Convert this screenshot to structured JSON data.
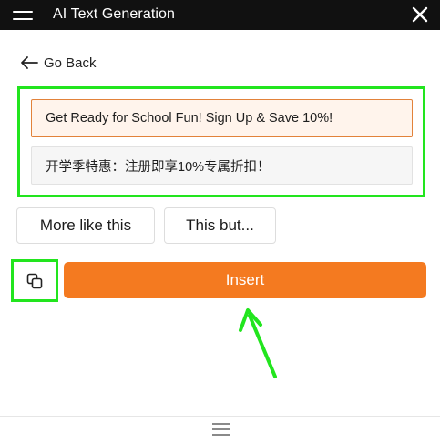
{
  "window": {
    "title": "AI Text Generation",
    "menu_icon": "hamburger-menu-icon",
    "close_icon": "close-x-icon"
  },
  "nav": {
    "back_label": "Go Back",
    "back_icon": "arrow-left-icon"
  },
  "results": [
    {
      "text": "Get Ready for School Fun! Sign Up & Save 10%!",
      "selected": true
    },
    {
      "text": "开学季特惠：注册即享10%专属折扣！",
      "selected": false
    }
  ],
  "actions": {
    "more_like_this": "More like this",
    "this_but": "This but...",
    "copy_icon": "copy-icon",
    "insert": "Insert"
  },
  "footer": {
    "handle_icon": "drag-handle-icon"
  },
  "colors": {
    "titlebar": "#111111",
    "accent": "#f47a20",
    "selected_bg": "#fff4ec",
    "selected_border": "#e2823a",
    "highlight": "#22e51e"
  }
}
